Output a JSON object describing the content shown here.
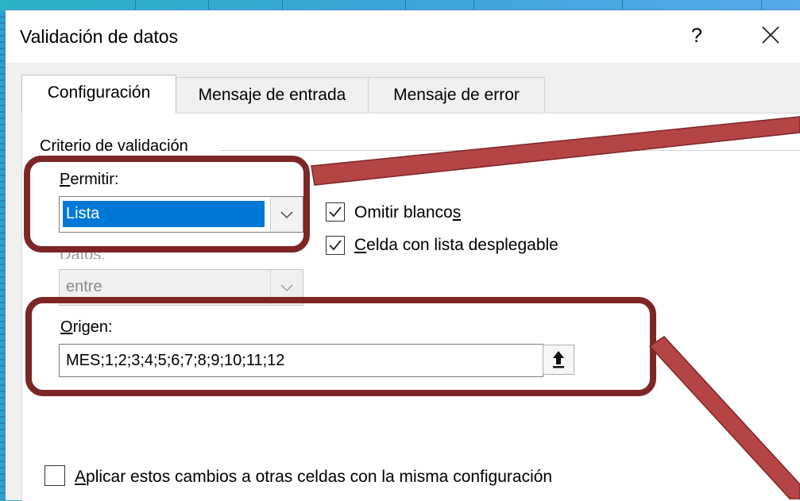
{
  "dialog": {
    "title": "Validación de datos",
    "help_label": "?",
    "close_icon": "close-icon"
  },
  "tabs": [
    {
      "label": "Configuración",
      "active": true
    },
    {
      "label": "Mensaje de entrada",
      "active": false
    },
    {
      "label": "Mensaje de error",
      "active": false
    }
  ],
  "criteria": {
    "group_label": "Criterio de validación",
    "allow_label_underlined": "P",
    "allow_label_rest": "ermitir:",
    "allow_value": "Lista",
    "data_label_partial": "Datos:",
    "data_value": "entre",
    "ignore_blank_label_main": "Omitir blanco",
    "ignore_blank_label_underlined": "s",
    "ignore_blank_checked": true,
    "dropdown_label_underlined": "C",
    "dropdown_label_rest": "elda con lista desplegable",
    "dropdown_checked": true,
    "source_label_underlined": "O",
    "source_label_rest": "rigen:",
    "source_value": "MES;1;2;3;4;5;6;7;8;9;10;11;12"
  },
  "apply_all": {
    "label_underlined": "A",
    "label_rest": "plicar estos cambios a otras celdas con la misma configuración",
    "checked": false
  },
  "colors": {
    "highlight": "#7e2526",
    "arrow": "#b54545",
    "selection": "#0078d7"
  }
}
